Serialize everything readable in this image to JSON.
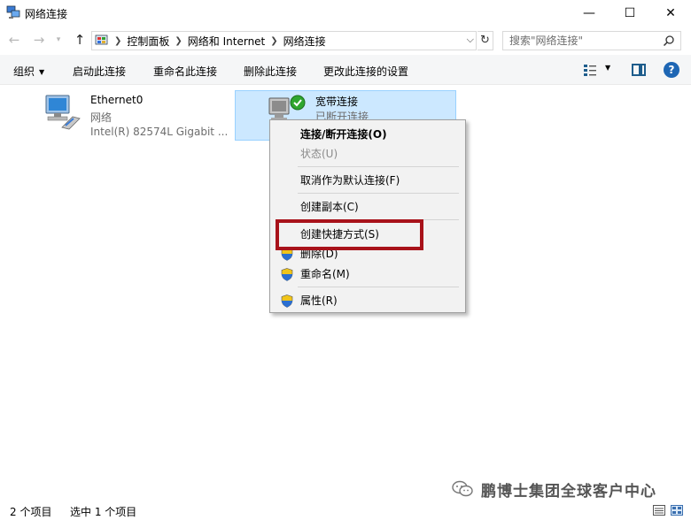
{
  "window": {
    "title": "网络连接",
    "minimize_glyph": "—",
    "maximize_glyph": "☐",
    "close_glyph": "✕"
  },
  "navigation": {
    "back_glyph": "←",
    "forward_glyph": "→",
    "recent_glyph": "▾",
    "up_glyph": "↑",
    "breadcrumbs": [
      "控制面板",
      "网络和 Internet",
      "网络连接"
    ],
    "refresh_glyph": "↻",
    "dropdown_glyph": "⌵"
  },
  "search": {
    "placeholder": "搜索\"网络连接\"",
    "icon": "search-icon"
  },
  "command_bar": {
    "organize": "组织",
    "organize_caret": "▼",
    "start": "启动此连接",
    "rename": "重命名此连接",
    "delete": "删除此连接",
    "change_settings": "更改此连接的设置",
    "view_caret": "▼",
    "help": "?"
  },
  "connections": [
    {
      "name": "Ethernet0",
      "type": "网络",
      "adapter": "Intel(R) 82574L Gigabit ..."
    },
    {
      "name": "宽带连接",
      "status": "已断开连接",
      "selected": true
    }
  ],
  "context_menu": {
    "items": [
      {
        "label": "连接/断开连接(O)",
        "bold": true
      },
      {
        "label": "状态(U)",
        "disabled": true
      },
      {
        "label": "取消作为默认连接(F)"
      },
      {
        "label": "创建副本(C)"
      },
      {
        "label": "创建快捷方式(S)",
        "highlighted": true
      },
      {
        "label": "删除(D)",
        "shield": true
      },
      {
        "label": "重命名(M)",
        "shield": true
      },
      {
        "label": "属性(R)",
        "shield": true
      }
    ]
  },
  "status_bar": {
    "item_count": "2 个项目",
    "selection": "选中 1 个项目"
  },
  "watermark": {
    "text": "鹏博士集团全球客户中心"
  },
  "colors": {
    "selection_bg": "#cce8ff",
    "highlight_border": "#a8121a",
    "help_blue": "#1e66b4"
  }
}
